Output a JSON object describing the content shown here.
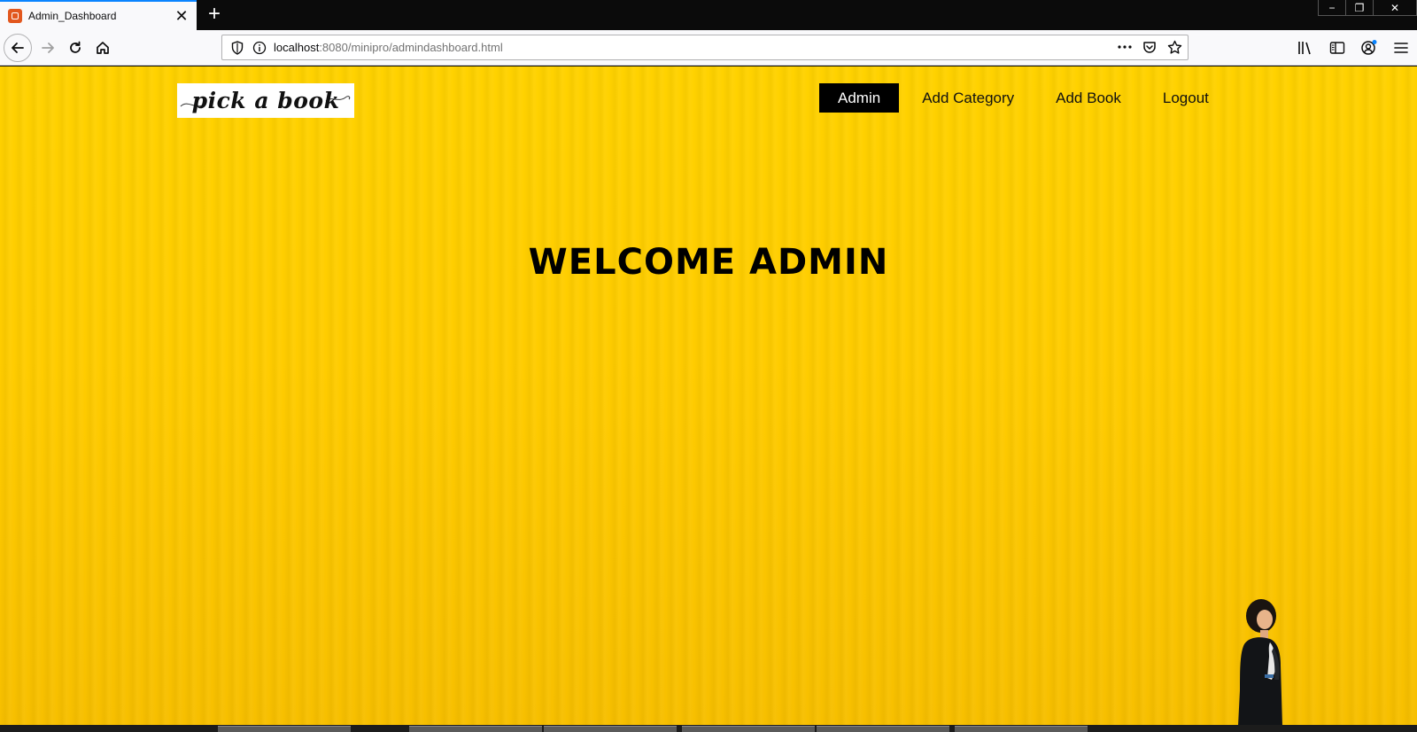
{
  "browser": {
    "tab_title": "Admin_Dashboard",
    "new_tab_label": "+",
    "url_host": "localhost",
    "url_rest": ":8080/minipro/admindashboard.html",
    "window_controls": {
      "minimize": "−",
      "restore": "❐",
      "close": "✕"
    }
  },
  "page": {
    "logo_text": "pick a book",
    "nav": [
      {
        "label": "Admin",
        "active": true
      },
      {
        "label": "Add Category",
        "active": false
      },
      {
        "label": "Add Book",
        "active": false
      },
      {
        "label": "Logout",
        "active": false
      }
    ],
    "welcome_heading": "WELCOME ADMIN"
  },
  "colors": {
    "background_yellow": "#ffcc00",
    "nav_active_bg": "#000000",
    "nav_active_text": "#ffffff",
    "tab_accent": "#0a84ff"
  },
  "icons": [
    "back-arrow-icon",
    "forward-arrow-icon",
    "reload-icon",
    "home-icon",
    "shield-icon",
    "info-icon",
    "more-icon",
    "pocket-icon",
    "star-icon",
    "library-icon",
    "sidebar-icon",
    "account-icon",
    "menu-icon"
  ]
}
